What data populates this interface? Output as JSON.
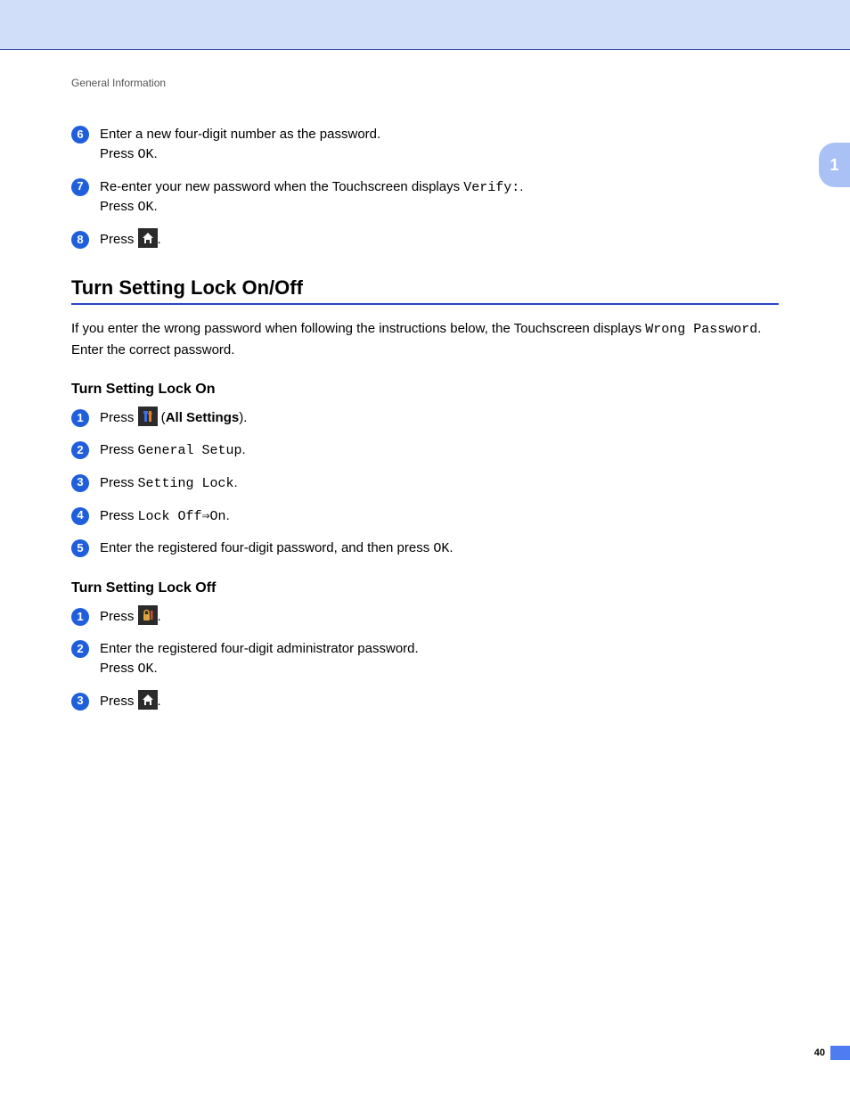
{
  "header": {
    "breadcrumb": "General Information"
  },
  "chapter_tab": "1",
  "page_number": "40",
  "continued_steps": [
    {
      "n": "6",
      "lines": [
        "Enter a new four-digit number as the password."
      ],
      "suffix": "Press ",
      "suffix_mono": "OK",
      "suffix_end": "."
    },
    {
      "n": "7",
      "lines_mixed": {
        "pre": "Re-enter your new password when the Touchscreen displays ",
        "mono": "Verify:",
        "post": "."
      },
      "suffix": "Press ",
      "suffix_mono": "OK",
      "suffix_end": "."
    },
    {
      "n": "8",
      "press_icon": "home",
      "trailing": "."
    }
  ],
  "section": {
    "title": "Turn Setting Lock On/Off",
    "intro_pre": "If you enter the wrong password when following the instructions below, the Touchscreen displays ",
    "intro_mono": "Wrong Password",
    "intro_post": ". Enter the correct password."
  },
  "lock_on": {
    "heading": "Turn Setting Lock On",
    "steps": [
      {
        "n": "1",
        "press_icon": "tools",
        "icon_suffix_pre": " (",
        "icon_suffix_bold": "All Settings",
        "icon_suffix_post": ")."
      },
      {
        "n": "2",
        "press_mono": "General Setup",
        "end": "."
      },
      {
        "n": "3",
        "press_mono": "Setting Lock",
        "end": "."
      },
      {
        "n": "4",
        "press_mono": "Lock Off⇒On",
        "end": "."
      },
      {
        "n": "5",
        "plain_pre": "Enter the registered four-digit password, and then press ",
        "plain_mono": "OK",
        "plain_post": "."
      }
    ]
  },
  "lock_off": {
    "heading": "Turn Setting Lock Off",
    "steps": [
      {
        "n": "1",
        "press_icon": "lock",
        "trailing": "."
      },
      {
        "n": "2",
        "lines": [
          "Enter the registered four-digit administrator password."
        ],
        "suffix": "Press ",
        "suffix_mono": "OK",
        "suffix_end": "."
      },
      {
        "n": "3",
        "press_icon": "home",
        "trailing": "."
      }
    ]
  },
  "labels": {
    "press": "Press "
  }
}
